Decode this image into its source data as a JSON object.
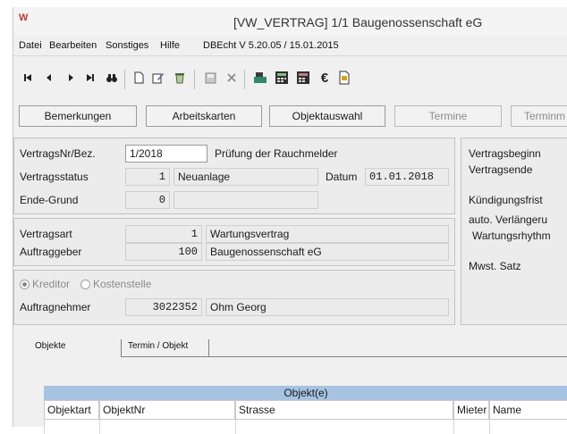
{
  "window": {
    "app_icon": "W",
    "title": "[VW_VERTRAG]  1/1 Baugenossenschaft eG"
  },
  "menu": {
    "items": [
      "Datei",
      "Bearbeiten",
      "Sonstiges",
      "Hilfe"
    ],
    "version": "DBEcht V 5.20.05 / 15.01.2015"
  },
  "toolbar": {
    "icons": [
      "first-record-icon",
      "previous-record-icon",
      "next-record-icon",
      "last-record-icon",
      "binoculars-icon",
      "new-document-icon",
      "edit-icon",
      "delete-icon",
      "save-icon",
      "cancel-icon",
      "cash-register-icon",
      "calculator-icon",
      "calculator-alt-icon",
      "euro-icon",
      "export-icon"
    ],
    "euro_symbol": "€"
  },
  "actions": {
    "bemerkungen": "Bemerkungen",
    "arbeitskarten": "Arbeitskarten",
    "objektauswahl": "Objektauswahl",
    "termine": "Termine",
    "terminm": "Terminm"
  },
  "contract": {
    "nr_label": "VertragsNr/Bez.",
    "nr_value": "1/2018",
    "bez_value": "Prüfung der Rauchmelder",
    "status_label": "Vertragsstatus",
    "status_code": "1",
    "status_text": "Neuanlage",
    "datum_label": "Datum",
    "datum_value": "01.01.2018",
    "ende_label": "Ende-Grund",
    "ende_code": "0",
    "art_label": "Vertragsart",
    "art_code": "1",
    "art_text": "Wartungsvertrag",
    "auftraggeber_label": "Auftraggeber",
    "auftraggeber_code": "100",
    "auftraggeber_text": "Baugenossenschaft eG",
    "kreditor_label": "Kreditor",
    "kostenstelle_label": "Kostenstelle",
    "auftragnehmer_label": "Auftragnehmer",
    "auftragnehmer_code": "3022352",
    "auftragnehmer_text": "Ohm Georg"
  },
  "right_panel": {
    "vertragsbeginn": "Vertragsbeginn",
    "vertragsende": "Vertragsende",
    "kuendigungsfrist": "Kündigungsfrist",
    "auto_verlaengerung": "auto. Verlängeru",
    "wartungsrhythmus": "Wartungsrhythm",
    "mwst_satz": "Mwst. Satz"
  },
  "tabs": {
    "objekte": "Objekte",
    "termin_objekt": "Termin / Objekt"
  },
  "table": {
    "group_header": "Objekt(e)",
    "columns": [
      "Objektart",
      "ObjektNr",
      "Strasse",
      "Mieter",
      "Name"
    ]
  }
}
